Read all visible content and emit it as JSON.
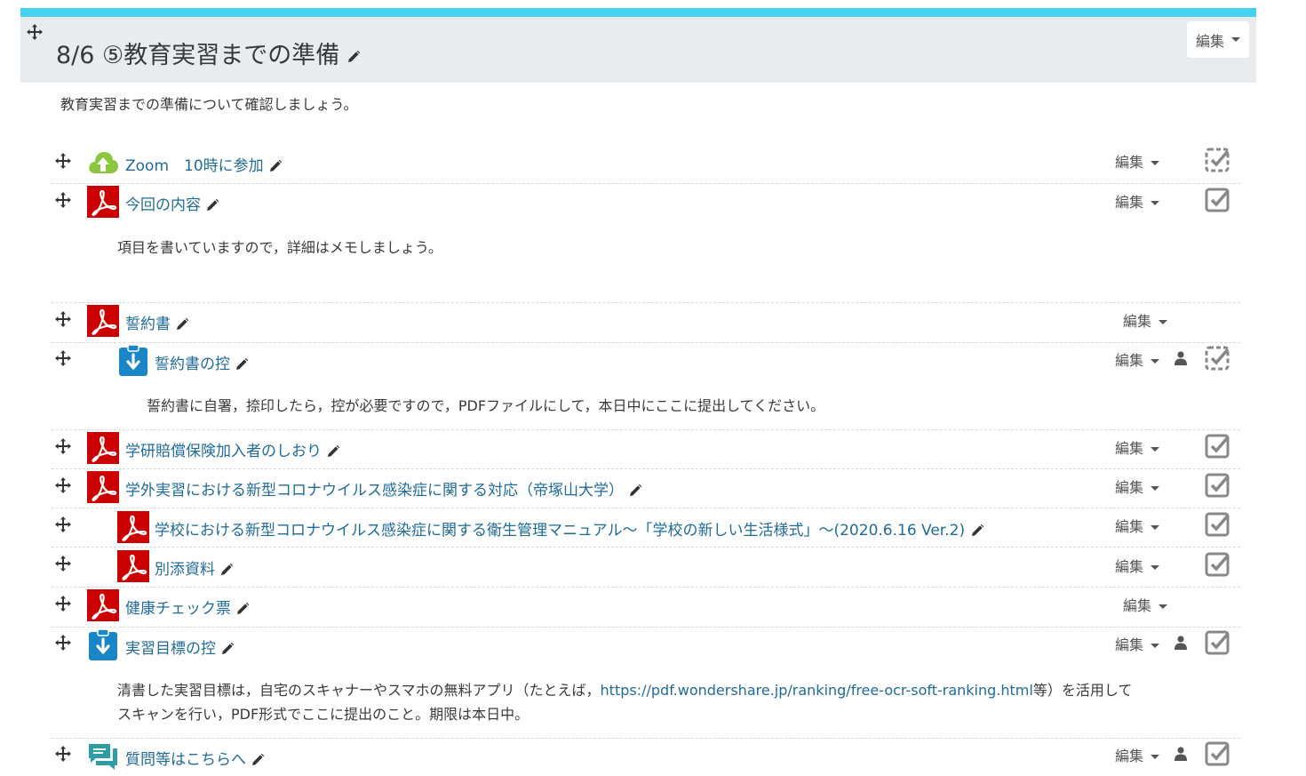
{
  "section": {
    "title": "8/6 ⑤教育実習までの準備",
    "summary": "教育実習までの準備について確認しましょう。",
    "edit_label": "編集"
  },
  "activities": [
    {
      "name": "Zoom　10時に参加",
      "icon": "url-upload-icon",
      "edit": "編集"
    },
    {
      "name": "今回の内容",
      "icon": "pdf-icon",
      "edit": "編集"
    },
    {
      "name": "誓約書",
      "icon": "pdf-icon",
      "edit": "編集"
    },
    {
      "name": "誓約書の控",
      "icon": "assignment-icon",
      "edit": "編集"
    },
    {
      "name": "学研賠償保険加入者のしおり",
      "icon": "pdf-icon",
      "edit": "編集"
    },
    {
      "name": "学外実習における新型コロナウイルス感染症に関する対応（帝塚山大学）",
      "icon": "pdf-icon",
      "edit": "編集"
    },
    {
      "name": "学校における新型コロナウイルス感染症に関する衛生管理マニュアル～「学校の新しい生活様式」～(2020.6.16 Ver.2)",
      "icon": "pdf-icon",
      "edit": "編集"
    },
    {
      "name": "別添資料",
      "icon": "pdf-icon",
      "edit": "編集"
    },
    {
      "name": "健康チェック票",
      "icon": "pdf-icon",
      "edit": "編集"
    },
    {
      "name": "実習目標の控",
      "icon": "assignment-icon",
      "edit": "編集"
    },
    {
      "name": "質問等はこちらへ",
      "icon": "forum-icon",
      "edit": "編集"
    }
  ],
  "labels": {
    "content_note": "項目を書いていますので，詳細はメモしましょう。",
    "pledge_note": "誓約書に自署，捺印したら，控が必要ですので，PDFファイルにして，本日中にここに提出してください。",
    "goal_note_1": "清書した実習目標は，自宅のスキャナーやスマホの無料アプリ（たとえば，",
    "goal_link": "https://pdf.wondershare.jp/ranking/free-ocr-soft-ranking.html",
    "goal_note_2": "等）を活用して",
    "goal_note_3": "スキャンを行い，PDF形式でここに提出のこと。期限は本日中。"
  },
  "colors": {
    "accent_bar": "#45d2ef",
    "header_bg": "#e9ecef",
    "link": "#1f6b9a",
    "pdf_red": "#cc0000",
    "assign_blue": "#1a86c8",
    "url_green": "#8cc63f",
    "forum_teal": "#2d9da6"
  }
}
